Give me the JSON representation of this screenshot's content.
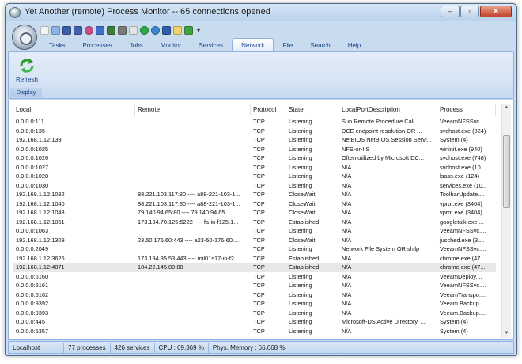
{
  "window": {
    "title": "Yet Another (remote) Process Monitor -- 65 connections opened",
    "controls": {
      "minimize": "–",
      "maximize": "▫",
      "close": "✕"
    }
  },
  "quick_access": {
    "icons": [
      "new-doc-icon",
      "open-icon",
      "monitor-icon",
      "ram-icon",
      "target-icon",
      "info-icon",
      "shield-icon",
      "network-card-icon",
      "clipboard-icon",
      "add-icon",
      "globe-icon",
      "save-icon",
      "document-icon",
      "check-icon"
    ],
    "icon_colors": [
      "#f4f4f4",
      "#8fb4e3",
      "#3b5ea8",
      "#4660b0",
      "#c94d8a",
      "#3f6fc9",
      "#3c7d3c",
      "#7a7a7a",
      "#e3e3e3",
      "#2da84b",
      "#3b86cf",
      "#2f5ea8",
      "#f2d36b",
      "#3fa33f"
    ],
    "dropdown": "▾"
  },
  "tabs": [
    "Tasks",
    "Processes",
    "Jobs",
    "Monitor",
    "Services",
    "Network",
    "File",
    "Search",
    "Help"
  ],
  "active_tab": "Network",
  "ribbon": {
    "refresh_label": "Refresh",
    "group_label": "Display"
  },
  "grid": {
    "columns": [
      "Local",
      "Remote",
      "Protocol",
      "State",
      "LocalPortDescription",
      "Process"
    ],
    "rows": [
      [
        "0.0.0.0:111",
        "",
        "TCP",
        "Listening",
        "Sun Remote Procedure Call",
        "VeeamNFSSvc...."
      ],
      [
        "0.0.0.0:135",
        "",
        "TCP",
        "Listening",
        "DCE endpoint resolution OR ...",
        "svchost.exe (824)"
      ],
      [
        "192.168.1.12:139",
        "",
        "TCP",
        "Listening",
        "NetBIOS NetBIOS Session Servi...",
        "System (4)"
      ],
      [
        "0.0.0.0:1025",
        "",
        "TCP",
        "Listening",
        "NFS-or-IIS",
        "wininit.exe (940)"
      ],
      [
        "0.0.0.0:1026",
        "",
        "TCP",
        "Listening",
        "Often utilized by Microsoft DC...",
        "svchost.exe (748)"
      ],
      [
        "0.0.0.0:1027",
        "",
        "TCP",
        "Listening",
        "N/A",
        "svchost.exe (10..."
      ],
      [
        "0.0.0.0:1028",
        "",
        "TCP",
        "Listening",
        "N/A",
        "lsass.exe (124)"
      ],
      [
        "0.0.0.0:1030",
        "",
        "TCP",
        "Listening",
        "N/A",
        "services.exe (10..."
      ],
      [
        "192.168.1.12:1032",
        "88.221.103.117:80  ----  a88-221-103-1...",
        "TCP",
        "CloseWait",
        "N/A",
        "ToolbarUpdate...."
      ],
      [
        "192.168.1.12:1040",
        "88.221.103.117:80  ----  a88-221-103-1...",
        "TCP",
        "CloseWait",
        "N/A",
        "vprot.exe (3404)"
      ],
      [
        "192.168.1.12:1043",
        "79.140.94.65:80  ----  79.140.94.65",
        "TCP",
        "CloseWait",
        "N/A",
        "vprot.exe (3404)"
      ],
      [
        "192.168.1.12:1051",
        "173.194.70.125:5222  ----  fa-in-f125.1...",
        "TCP",
        "Established",
        "N/A",
        "googletalk.exe...."
      ],
      [
        "0.0.0.0:1063",
        "",
        "TCP",
        "Listening",
        "N/A",
        "VeeamNFSSvc...."
      ],
      [
        "192.168.1.12:1309",
        "23.50.176.60:443  ----  a23-50-176-60....",
        "TCP",
        "CloseWait",
        "N/A",
        "jusched.exe (3...."
      ],
      [
        "0.0.0.0:2049",
        "",
        "TCP",
        "Listening",
        "Network File System OR shilp",
        "VeeamNFSSvc...."
      ],
      [
        "192.168.1.12:3626",
        "173.194.35.53:443  ----  mil01s17-in-f2...",
        "TCP",
        "Established",
        "N/A",
        "chrome.exe (47..."
      ],
      [
        "192.168.1.12:4071",
        "184.22.145.80:80",
        "TCP",
        "Established",
        "N/A",
        "chrome.exe (47..."
      ],
      [
        "0.0.0.0:6160",
        "",
        "TCP",
        "Listening",
        "N/A",
        "VeeamDeploy...."
      ],
      [
        "0.0.0.0:6161",
        "",
        "TCP",
        "Listening",
        "N/A",
        "VeeamNFSSvc...."
      ],
      [
        "0.0.0.0:6162",
        "",
        "TCP",
        "Listening",
        "N/A",
        "VeeamTranspo...."
      ],
      [
        "0.0.0.0:9392",
        "",
        "TCP",
        "Listening",
        "N/A",
        "Veeam.Backup...."
      ],
      [
        "0.0.0.0:9393",
        "",
        "TCP",
        "Listening",
        "N/A",
        "Veeam.Backup...."
      ],
      [
        "0.0.0.0:445",
        "",
        "TCP",
        "Listening",
        "Microsoft-DS Active Directory, ...",
        "System (4)"
      ],
      [
        "0.0.0.0:5357",
        "",
        "TCP",
        "Listening",
        "N/A",
        "System (4)"
      ]
    ],
    "selected_row": 16
  },
  "scrollbar": {
    "up": "▲",
    "down": "▼"
  },
  "status": {
    "host": "Localhost",
    "processes": "77 processes",
    "services": "426 services",
    "cpu": "CPU : 09.369 %",
    "memory": "Phys. Memory : 66.668 %"
  }
}
